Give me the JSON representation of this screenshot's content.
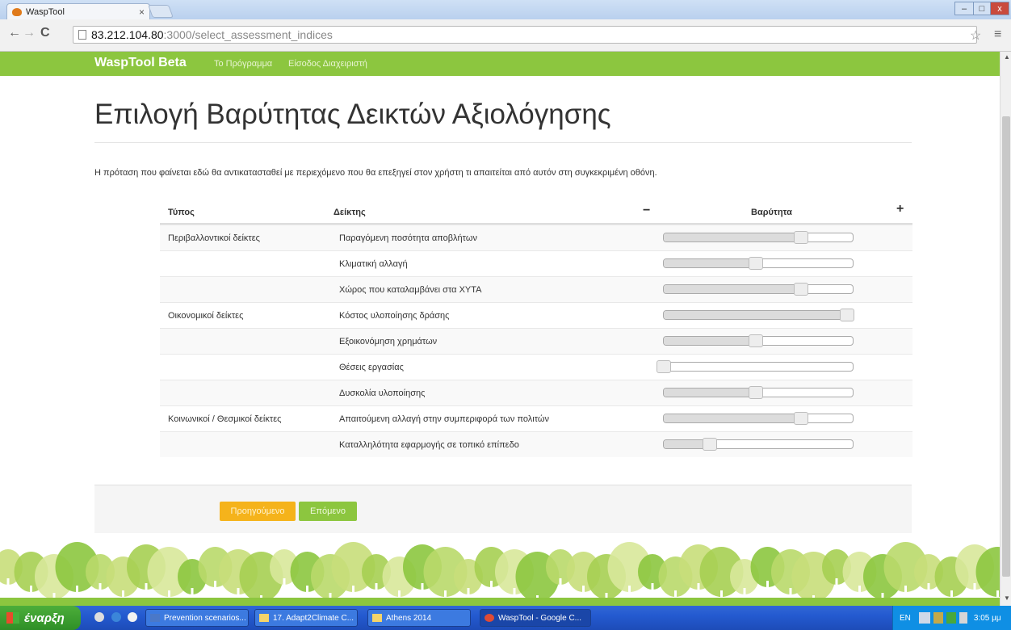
{
  "browser": {
    "tab_title": "WaspTool",
    "tab_close": "×",
    "url_host": "83.212.104.80",
    "url_path": ":3000/select_assessment_indices",
    "min_glyph": "–",
    "max_glyph": "□",
    "close_glyph": "x",
    "back_glyph": "←",
    "fwd_glyph": "→",
    "reload_glyph": "C",
    "star_glyph": "☆",
    "menu_glyph": "≡"
  },
  "nav": {
    "brand": "WaspTool Beta",
    "links": [
      "Το Πρόγραμμα",
      "Είσοδος Διαχειριστή"
    ]
  },
  "page": {
    "title": "Επιλογή Βαρύτητας Δεικτών Αξιολόγησης",
    "intro": "Η πρόταση που φαίνεται εδώ θα αντικατασταθεί με περιεχόμενο που θα επεξηγεί στον χρήστη τι απαιτείται από αυτόν στη συγκεκριμένη οθόνη."
  },
  "table": {
    "headers": {
      "type": "Τύπος",
      "indicator": "Δείκτης",
      "weight": "Βαρύτητα",
      "minus": "−",
      "plus": "+"
    },
    "rows": [
      {
        "type": "Περιβαλλοντικοί δείκτες",
        "indicator": "Παραγόμενη ποσότητα αποβλήτων",
        "weight": 0.75
      },
      {
        "type": "",
        "indicator": "Κλιματική αλλαγή",
        "weight": 0.5
      },
      {
        "type": "",
        "indicator": "Χώρος που καταλαμβάνει στα ΧΥΤΑ",
        "weight": 0.75
      },
      {
        "type": "Οικονομικοί δείκτες",
        "indicator": "Κόστος υλοποίησης δράσης",
        "weight": 1.0
      },
      {
        "type": "",
        "indicator": "Εξοικονόμηση χρημάτων",
        "weight": 0.5
      },
      {
        "type": "",
        "indicator": "Θέσεις εργασίας",
        "weight": 0.0
      },
      {
        "type": "",
        "indicator": "Δυσκολία υλοποίησης",
        "weight": 0.5
      },
      {
        "type": "Κοινωνικοί / Θεσμικοί δείκτες",
        "indicator": "Απαιτούμενη αλλαγή στην συμπεριφορά των πολιτών",
        "weight": 0.75
      },
      {
        "type": "",
        "indicator": "Καταλληλότητα εφαρμογής σε τοπικό επίπεδο",
        "weight": 0.25
      }
    ]
  },
  "buttons": {
    "prev": "Προηγούμενο",
    "next": "Επόμενο"
  },
  "taskbar": {
    "start": "έναρξη",
    "tasks": [
      "Prevention scenarios...",
      "17. Adapt2Climate C...",
      "Athens 2014",
      "WaspTool - Google C..."
    ],
    "lang": "EN",
    "clock": "3:05 μμ"
  },
  "colors": {
    "brand_green": "#8cc63f",
    "prev_orange": "#f5b31b"
  }
}
